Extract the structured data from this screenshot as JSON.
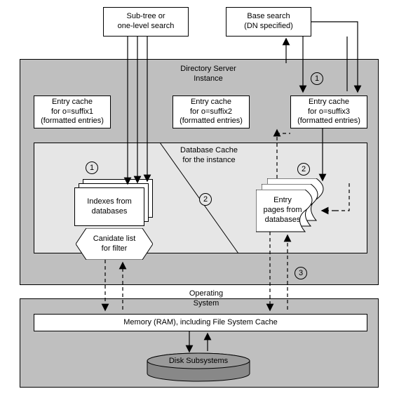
{
  "top": {
    "subtree_search": "Sub-tree or\none-level search",
    "base_search": "Base search\n(DN specified)"
  },
  "instance": {
    "title": "Directory Server\nInstance",
    "entry_cache_1": "Entry cache\nfor o=suffix1\n(formatted entries)",
    "entry_cache_2": "Entry cache\nfor o=suffix2\n(formatted entries)",
    "entry_cache_3": "Entry cache\nfor o=suffix3\n(formatted entries)",
    "db_cache": {
      "title": "Database Cache\nfor the instance",
      "indexes": "Indexes from\ndatabases",
      "candidate": "Canidate list\nfor filter",
      "entry_pages": "Entry\npages from\ndatabases"
    }
  },
  "os": {
    "title": "Operating\nSystem",
    "ram": "Memory (RAM), including File System Cache",
    "disk": "Disk Subsystems"
  },
  "step_markers": {
    "one_a": "1",
    "one_b": "1",
    "two_a": "2",
    "two_b": "2",
    "three": "3"
  }
}
